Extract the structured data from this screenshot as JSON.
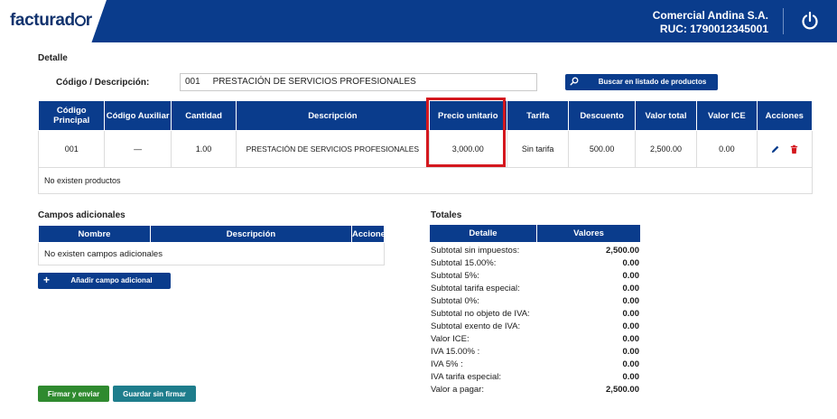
{
  "header": {
    "logo_text": "facturad",
    "logo_tail": "r",
    "company_name": "Comercial Andina S.A.",
    "ruc": "RUC: 1790012345001",
    "brand_color": "#0a3c8c"
  },
  "detalle": {
    "title": "Detalle",
    "code_label": "Código / Descripción:",
    "code_value": "001     PRESTACIÓN DE SERVICIOS PROFESIONALES",
    "search_button": "Buscar en listado de productos"
  },
  "products_table": {
    "headers": [
      "Código Principal",
      "Código Auxiliar",
      "Cantidad",
      "Descripción",
      "Precio unitario",
      "Tarifa",
      "Descuento",
      "Valor total",
      "Valor ICE",
      "Acciones"
    ],
    "rows": [
      {
        "codigo_principal": "001",
        "codigo_auxiliar": "—",
        "cantidad": "1.00",
        "descripcion": "PRESTACIÓN DE SERVICIOS PROFESIONALES",
        "precio_unitario": "3,000.00",
        "tarifa": "Sin tarifa",
        "descuento": "500.00",
        "valor_total": "2,500.00",
        "valor_ice": "0.00"
      }
    ],
    "empty_text": "No existen productos",
    "highlight_color": "#d4181e"
  },
  "campos_adicionales": {
    "title": "Campos adicionales",
    "headers": [
      "Nombre",
      "Descripción",
      "Acciones"
    ],
    "empty_text": "No existen campos adicionales",
    "add_button": "Añadir campo adicional"
  },
  "totales": {
    "title": "Totales",
    "headers": [
      "Detalle",
      "Valores"
    ],
    "rows": [
      {
        "label": "Subtotal sin impuestos:",
        "value": "2,500.00"
      },
      {
        "label": "Subtotal 15.00%:",
        "value": "0.00"
      },
      {
        "label": "Subtotal 5%:",
        "value": "0.00"
      },
      {
        "label": "Subtotal tarifa especial:",
        "value": "0.00"
      },
      {
        "label": "Subtotal 0%:",
        "value": "0.00"
      },
      {
        "label": "Subtotal no objeto de IVA:",
        "value": "0.00"
      },
      {
        "label": "Subtotal exento de IVA:",
        "value": "0.00"
      },
      {
        "label": "Valor ICE:",
        "value": "0.00"
      },
      {
        "label": "IVA 15.00% :",
        "value": "0.00"
      },
      {
        "label": "IVA 5% :",
        "value": "0.00"
      },
      {
        "label": "IVA tarifa especial:",
        "value": "0.00"
      },
      {
        "label": "Valor a pagar:",
        "value": "2,500.00"
      }
    ]
  },
  "footer": {
    "sign_button": "Firmar y enviar",
    "save_button": "Guardar sin firmar"
  },
  "icons": {
    "power": "power-icon",
    "search": "search-icon",
    "edit": "pencil-icon",
    "delete": "trash-icon",
    "add": "plus-icon"
  }
}
